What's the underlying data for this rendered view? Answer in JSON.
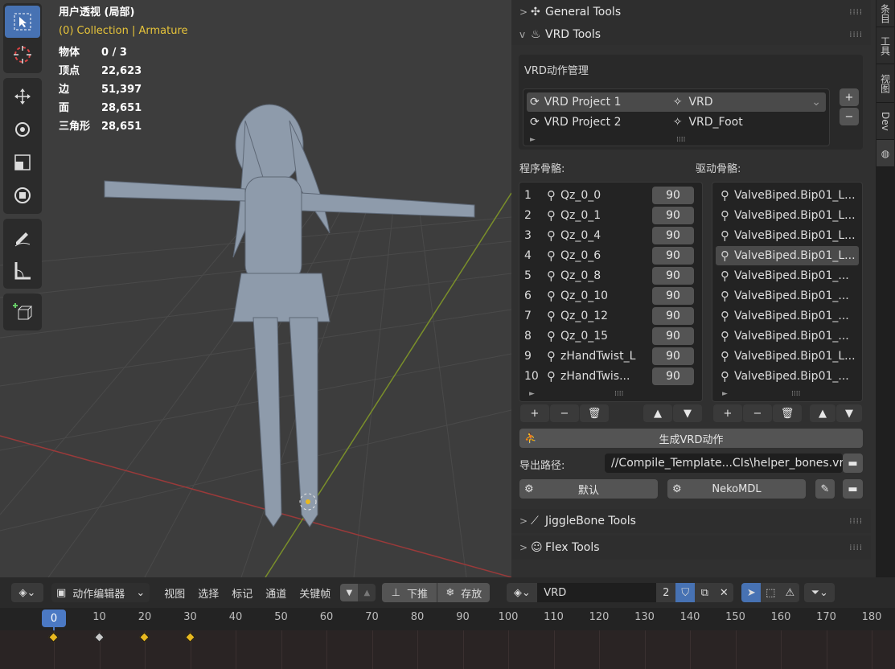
{
  "viewport": {
    "title": "用户透视 (局部)",
    "collection": "(0) Collection | Armature",
    "stats": [
      {
        "label": "物体",
        "value": "0 / 3"
      },
      {
        "label": "顶点",
        "value": "22,623"
      },
      {
        "label": "边",
        "value": "51,397"
      },
      {
        "label": "面",
        "value": "28,651"
      },
      {
        "label": "三角形",
        "value": "28,651"
      }
    ]
  },
  "panels": {
    "general_tools": "General Tools",
    "vrd_tools": "VRD Tools",
    "jiggle_tools": "JiggleBone Tools",
    "flex_tools": "Flex Tools"
  },
  "vrd": {
    "manage_label": "VRD动作管理",
    "projects": [
      {
        "name": "VRD Project 1",
        "action": "VRD"
      },
      {
        "name": "VRD Project 2",
        "action": "VRD_Foot"
      }
    ],
    "program_bones_label": "程序骨骼:",
    "driver_bones_label": "驱动骨骼:",
    "program_bones": [
      {
        "index": "1",
        "name": "Qz_0_0",
        "value": "90"
      },
      {
        "index": "2",
        "name": "Qz_0_1",
        "value": "90"
      },
      {
        "index": "3",
        "name": "Qz_0_4",
        "value": "90"
      },
      {
        "index": "4",
        "name": "Qz_0_6",
        "value": "90"
      },
      {
        "index": "5",
        "name": "Qz_0_8",
        "value": "90"
      },
      {
        "index": "6",
        "name": "Qz_0_10",
        "value": "90"
      },
      {
        "index": "7",
        "name": "Qz_0_12",
        "value": "90"
      },
      {
        "index": "8",
        "name": "Qz_0_15",
        "value": "90"
      },
      {
        "index": "9",
        "name": "zHandTwist_L",
        "value": "90"
      },
      {
        "index": "10",
        "name": "zHandTwis...",
        "value": "90"
      }
    ],
    "driver_bones": [
      "ValveBiped.Bip01_L...",
      "ValveBiped.Bip01_L...",
      "ValveBiped.Bip01_L...",
      "ValveBiped.Bip01_L...",
      "ValveBiped.Bip01_...",
      "ValveBiped.Bip01_...",
      "ValveBiped.Bip01_...",
      "ValveBiped.Bip01_...",
      "ValveBiped.Bip01_L...",
      "ValveBiped.Bip01_..."
    ],
    "generate_label": "生成VRD动作",
    "export_label": "导出路径:",
    "export_path": "//Compile_Template...CIs\\helper_bones.vrd",
    "default_label": "默认",
    "nekomdl_label": "NekoMDL"
  },
  "sidetabs": [
    "条目",
    "工具",
    "视图",
    "Dev"
  ],
  "timeline": {
    "editor": "动作编辑器",
    "menus": [
      "视图",
      "选择",
      "标记",
      "通道",
      "关键帧"
    ],
    "push_down": "下推",
    "stash": "存放",
    "action": "VRD",
    "users": "2",
    "current_frame": "0",
    "ticks": [
      "10",
      "20",
      "30",
      "40",
      "50",
      "60",
      "70",
      "80",
      "90",
      "100",
      "110",
      "120",
      "130",
      "140",
      "150",
      "160",
      "170",
      "180"
    ],
    "keyframes": [
      0,
      10,
      20,
      30
    ],
    "colors": {
      "accent": "#4772b3",
      "keyframe_selected": "#e8b820",
      "keyframe": "#c8c8c8"
    }
  }
}
